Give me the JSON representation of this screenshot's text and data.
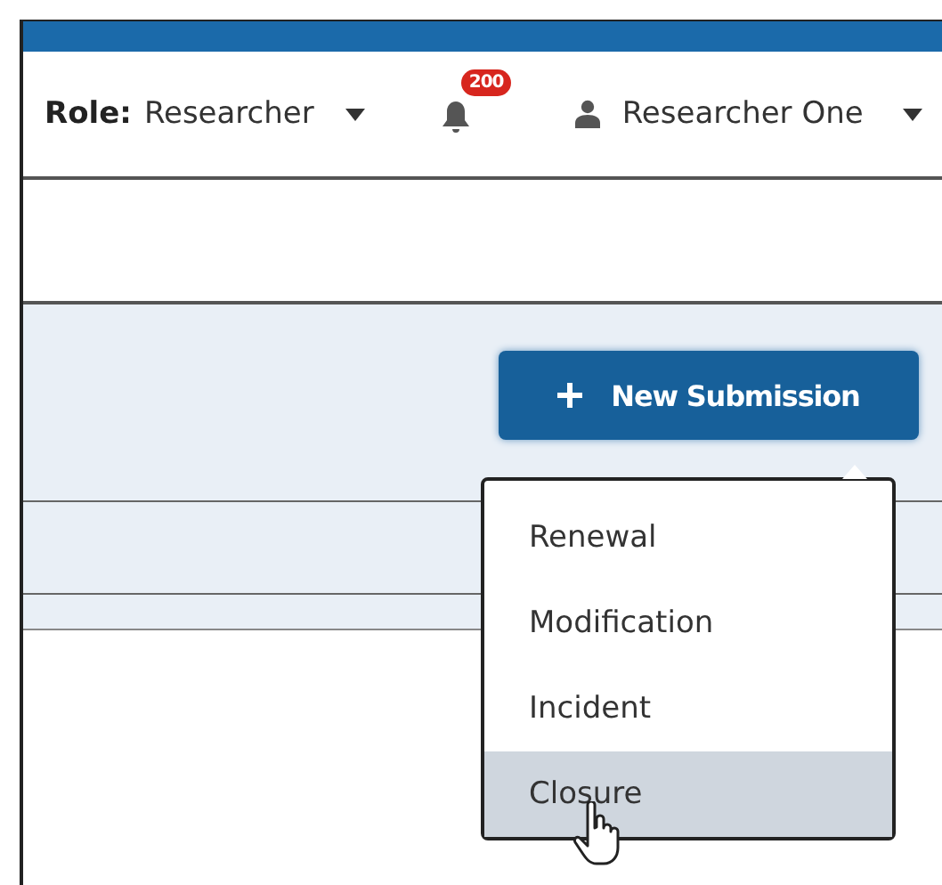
{
  "header": {
    "role_label": "Role:",
    "role": "Researcher",
    "notification_count": "200",
    "user": "Researcher One"
  },
  "new_submission": {
    "label": "New Submission",
    "menu": [
      {
        "label": "Renewal",
        "selected": false
      },
      {
        "label": "Modification",
        "selected": false
      },
      {
        "label": "Incident",
        "selected": false
      },
      {
        "label": "Closure",
        "selected": true
      }
    ]
  }
}
